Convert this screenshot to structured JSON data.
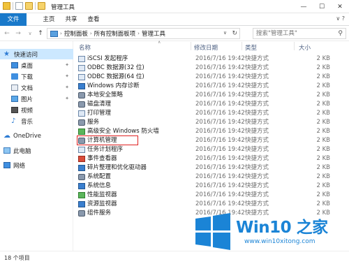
{
  "window": {
    "title": "管理工具",
    "controls": [
      "—",
      "☐",
      "✕"
    ]
  },
  "ribbon": {
    "tabs": [
      "文件",
      "主页",
      "共享",
      "查看"
    ],
    "help": "∨ ?"
  },
  "address": {
    "crumbs": [
      "控制面板",
      "所有控制面板项",
      "管理工具"
    ],
    "search_placeholder": "搜索\"管理工具\""
  },
  "sidebar": {
    "items": [
      {
        "label": "快速访问",
        "icon": "star-icon",
        "pinned": false
      },
      {
        "label": "桌面",
        "icon": "desktop-icon",
        "pinned": true
      },
      {
        "label": "下载",
        "icon": "download-icon",
        "pinned": true
      },
      {
        "label": "文档",
        "icon": "documents-icon",
        "pinned": true
      },
      {
        "label": "图片",
        "icon": "pictures-icon",
        "pinned": true
      },
      {
        "label": "视频",
        "icon": "videos-icon",
        "pinned": false
      },
      {
        "label": "音乐",
        "icon": "music-icon",
        "pinned": false
      },
      {
        "label": "OneDrive",
        "icon": "onedrive-icon",
        "pinned": false
      },
      {
        "label": "此电脑",
        "icon": "this-pc-icon",
        "pinned": false
      },
      {
        "label": "网络",
        "icon": "network-icon",
        "pinned": false
      }
    ]
  },
  "columns": {
    "name": "名称",
    "date": "修改日期",
    "type": "类型",
    "size": "大小"
  },
  "files": [
    {
      "name": "iSCSI 发起程序",
      "date": "2016/7/16 19:42",
      "type": "快捷方式",
      "size": "2 KB",
      "icon": "ri-shortcut"
    },
    {
      "name": "ODBC 数据源(32 位)",
      "date": "2016/7/16 19:42",
      "type": "快捷方式",
      "size": "2 KB",
      "icon": "ri-shortcut"
    },
    {
      "name": "ODBC 数据源(64 位)",
      "date": "2016/7/16 19:42",
      "type": "快捷方式",
      "size": "2 KB",
      "icon": "ri-shortcut"
    },
    {
      "name": "Windows 内存诊断",
      "date": "2016/7/16 19:42",
      "type": "快捷方式",
      "size": "2 KB",
      "icon": "ri-monitor"
    },
    {
      "name": "本地安全策略",
      "date": "2016/7/16 19:42",
      "type": "快捷方式",
      "size": "2 KB",
      "icon": "ri-gear"
    },
    {
      "name": "磁盘清理",
      "date": "2016/7/16 19:42",
      "type": "快捷方式",
      "size": "2 KB",
      "icon": "ri-gear"
    },
    {
      "name": "打印管理",
      "date": "2016/7/16 19:42",
      "type": "快捷方式",
      "size": "2 KB",
      "icon": "ri-shortcut"
    },
    {
      "name": "服务",
      "date": "2016/7/16 19:42",
      "type": "快捷方式",
      "size": "2 KB",
      "icon": "ri-gear"
    },
    {
      "name": "高级安全 Windows 防火墙",
      "date": "2016/7/16 19:42",
      "type": "快捷方式",
      "size": "2 KB",
      "icon": "ri-green"
    },
    {
      "name": "计算机管理",
      "date": "2016/7/16 19:42",
      "type": "快捷方式",
      "size": "2 KB",
      "icon": "ri-gear",
      "highlighted": true
    },
    {
      "name": "任务计划程序",
      "date": "2016/7/16 19:42",
      "type": "快捷方式",
      "size": "2 KB",
      "icon": "ri-shortcut"
    },
    {
      "name": "事件查看器",
      "date": "2016/7/16 19:42",
      "type": "快捷方式",
      "size": "2 KB",
      "icon": "ri-red"
    },
    {
      "name": "碎片整理和优化驱动器",
      "date": "2016/7/16 19:42",
      "type": "快捷方式",
      "size": "2 KB",
      "icon": "ri-monitor"
    },
    {
      "name": "系统配置",
      "date": "2016/7/16 19:42",
      "type": "快捷方式",
      "size": "2 KB",
      "icon": "ri-gear"
    },
    {
      "name": "系统信息",
      "date": "2016/7/16 19:42",
      "type": "快捷方式",
      "size": "2 KB",
      "icon": "ri-monitor"
    },
    {
      "name": "性能监视器",
      "date": "2016/7/16 19:42",
      "type": "快捷方式",
      "size": "2 KB",
      "icon": "ri-green"
    },
    {
      "name": "资源监视器",
      "date": "2016/7/16 19:42",
      "type": "快捷方式",
      "size": "2 KB",
      "icon": "ri-monitor"
    },
    {
      "name": "组件服务",
      "date": "2016/7/16 19:42",
      "type": "快捷方式",
      "size": "2 KB",
      "icon": "ri-gear"
    }
  ],
  "status": {
    "count": "18 个项目"
  },
  "watermark": {
    "title": "Win10 之家",
    "url": "www.win10xitong.com",
    "logo_color": "#1b84d6"
  }
}
